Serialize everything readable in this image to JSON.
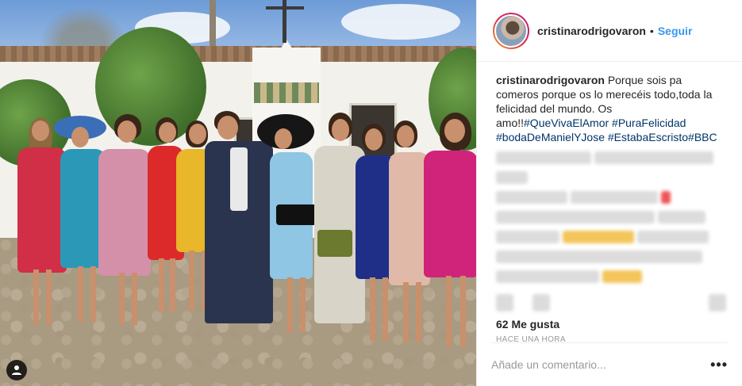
{
  "post": {
    "author": {
      "username": "cristinarodrigovaron",
      "separator": "•",
      "follow_label": "Seguir"
    },
    "caption": {
      "username": "cristinarodrigovaron",
      "text": "Porque sois pa comeros porque os lo merecéis todo,toda la felicidad del mundo. Os amo!!",
      "hashtags": [
        "#QueVivaElAmor",
        "#PuraFelicidad",
        "#bodaDeManielYJose",
        "#EstabaEscristo",
        "#BBC"
      ]
    },
    "likes": "62 Me gusta",
    "timestamp": "HACE UNA HORA",
    "comment_placeholder": "Añade un comentario...",
    "more_label": "•••"
  },
  "icons": {
    "user_tag": "user-tag-icon",
    "more_options": "more-options-icon"
  },
  "colors": {
    "follow": "#3897f0",
    "hashtag": "#003569",
    "border": "#efefef",
    "muted": "#999999"
  }
}
